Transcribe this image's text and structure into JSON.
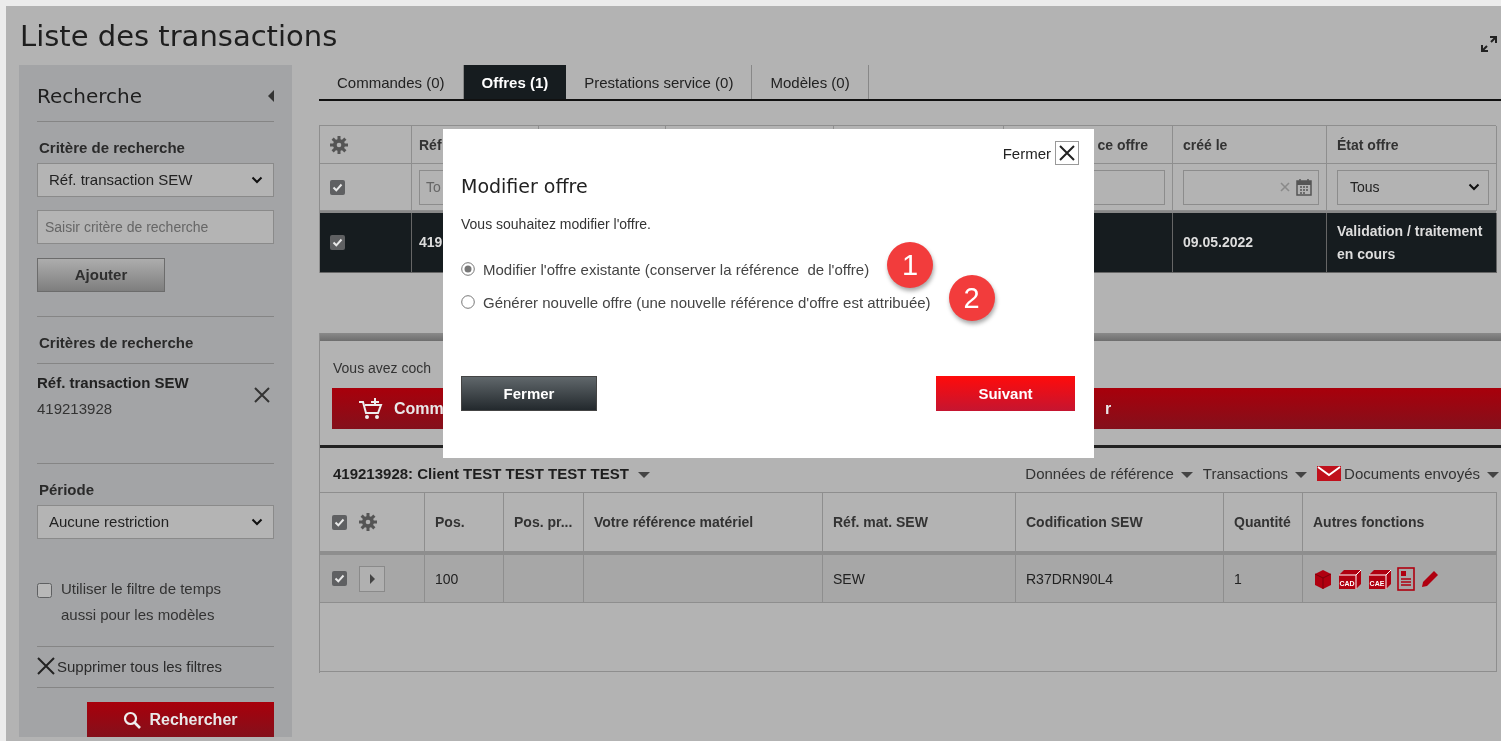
{
  "page": {
    "title": "Liste des transactions"
  },
  "sidebar": {
    "title": "Recherche",
    "criterion_label": "Critère de recherche",
    "criterion_select": "Réf. transaction SEW",
    "criterion_input": {
      "placeholder": "Saisir critère de recherche"
    },
    "add_button": "Ajouter",
    "criteria_heading": "Critères de recherche",
    "active_criteria": [
      {
        "label": "Réf. transaction SEW",
        "value": "419213928"
      }
    ],
    "period_label": "Période",
    "period_select": "Aucune restriction",
    "time_filter": {
      "label": "Utiliser le filtre de temps aussi pour les modèles",
      "checked": false
    },
    "clear_all": "Supprimer tous les filtres",
    "search_button": "Rechercher"
  },
  "tabs": [
    {
      "label": "Commandes (0)",
      "selected": false
    },
    {
      "label": "Offres (1)",
      "selected": true
    },
    {
      "label": "Prestations service (0)",
      "selected": false
    },
    {
      "label": "Modèles (0)",
      "selected": false
    }
  ],
  "offers_table": {
    "header": [
      {
        "kind": "gear"
      },
      {
        "kind": "text",
        "text": "Réf"
      },
      {
        "kind": "blank"
      },
      {
        "kind": "blank"
      },
      {
        "kind": "blank"
      },
      {
        "kind": "tail",
        "text": "ce offre"
      },
      {
        "kind": "text",
        "text": "créé le"
      },
      {
        "kind": "text",
        "text": "État offre"
      }
    ],
    "filter": [
      {
        "kind": "check",
        "checked": true
      },
      {
        "kind": "input",
        "placeholder": "To"
      },
      {
        "kind": "blank"
      },
      {
        "kind": "blank"
      },
      {
        "kind": "blank"
      },
      {
        "kind": "input"
      },
      {
        "kind": "date"
      },
      {
        "kind": "select",
        "value": "Tous"
      }
    ],
    "rows": [
      {
        "selected": true,
        "cells": [
          {
            "kind": "check",
            "checked": true
          },
          {
            "kind": "text",
            "text": "419"
          },
          {
            "kind": "blank"
          },
          {
            "kind": "blank"
          },
          {
            "kind": "blank"
          },
          {
            "kind": "blank"
          },
          {
            "kind": "text",
            "text": "09.05.2022"
          },
          {
            "kind": "text",
            "text": "Validation / traitement en cours"
          }
        ]
      }
    ]
  },
  "action_panel": {
    "message": "Vous avez coch",
    "buttons": [
      {
        "kind": "cart",
        "label": "Comm"
      },
      {
        "kind": "tail",
        "label": "r"
      }
    ]
  },
  "positions": {
    "title": "419213928: Client TEST TEST TEST TEST",
    "links": [
      {
        "kind": "menu",
        "label": "Données de référence"
      },
      {
        "kind": "menu",
        "label": "Transactions"
      },
      {
        "kind": "mail",
        "label": "Documents envoyés"
      }
    ],
    "header": [
      {
        "kind": "check_gear",
        "checked": true
      },
      {
        "kind": "text",
        "text": "Pos."
      },
      {
        "kind": "text",
        "text": "Pos. pr..."
      },
      {
        "kind": "text",
        "text": "Votre référence matériel"
      },
      {
        "kind": "text",
        "text": "Réf. mat. SEW"
      },
      {
        "kind": "text",
        "text": "Codification SEW"
      },
      {
        "kind": "text",
        "text": "Quantité"
      },
      {
        "kind": "text",
        "text": "Autres fonctions"
      }
    ],
    "rows": [
      {
        "selected": false,
        "cells": [
          {
            "kind": "check_expand",
            "checked": true
          },
          {
            "kind": "text",
            "text": "100"
          },
          {
            "kind": "blank"
          },
          {
            "kind": "blank"
          },
          {
            "kind": "text",
            "text": "SEW"
          },
          {
            "kind": "text",
            "text": "R37DRN90L4"
          },
          {
            "kind": "text",
            "text": "1"
          },
          {
            "kind": "functions",
            "items": [
              {
                "kind": "box"
              },
              {
                "kind": "cad",
                "label": "CAD"
              },
              {
                "kind": "cad",
                "label": "CAE"
              },
              {
                "kind": "sheet"
              },
              {
                "kind": "edit"
              }
            ]
          }
        ]
      }
    ]
  },
  "dialog": {
    "close_label": "Fermer",
    "title": "Modifier offre",
    "message": "Vous souhaitez modifier l'offre.",
    "options": [
      {
        "label": "Modifier l'offre existante (conserver la référence  de l'offre)",
        "selected": true,
        "badge": "1"
      },
      {
        "label": "Générer nouvelle offre (une nouvelle référence d'offre est attribuée)",
        "selected": false,
        "badge": "2"
      }
    ],
    "buttons": [
      {
        "kind": "secondary",
        "label": "Fermer"
      },
      {
        "kind": "primary",
        "label": "Suivant"
      }
    ]
  }
}
